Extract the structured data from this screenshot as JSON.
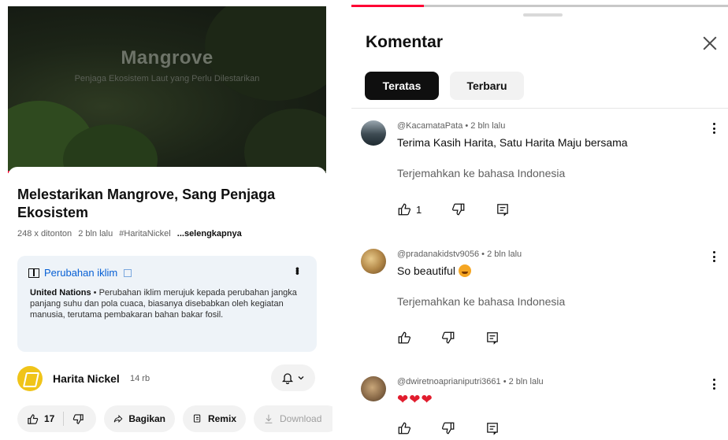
{
  "video": {
    "overlay_title": "Mangrove",
    "overlay_subtitle": "Penjaga Ekosistem Laut yang Perlu Dilestarikan",
    "progress": 0.05
  },
  "details": {
    "title": "Melestarikan Mangrove, Sang Penjaga Ekosistem",
    "views": "248 x ditonton",
    "age": "2 bln lalu",
    "hashtag": "#HaritaNickel",
    "more_label": "...selengkapnya"
  },
  "info_panel": {
    "topic": "Perubahan iklim",
    "source": "United Nations",
    "body": " • Perubahan iklim merujuk kepada perubahan jangka panjang suhu dan pola cuaca, biasanya disebabkan oleh kegiatan manusia, terutama pembakaran bahan bakar fosil."
  },
  "channel": {
    "name": "Harita Nickel",
    "subscribers": "14 rb"
  },
  "actions": {
    "likes": "17",
    "share_label": "Bagikan",
    "remix_label": "Remix",
    "download_label": "Download"
  },
  "comments_panel": {
    "title": "Komentar",
    "tabs": [
      {
        "label": "Teratas",
        "active": true
      },
      {
        "label": "Terbaru",
        "active": false
      }
    ],
    "translate_label": "Terjemahkan ke bahasa Indonesia",
    "items": [
      {
        "author": "@KacamataPata",
        "time": "2 bln lalu",
        "text": "Terima Kasih Harita, Satu Harita Maju bersama",
        "likes": "1"
      },
      {
        "author": "@pradanakidstv9056",
        "time": "2 bln lalu",
        "text": "So beautiful",
        "likes": ""
      },
      {
        "author": "@dwiretnoaprianiputri3661",
        "time": "2 bln lalu",
        "text": "❤❤❤",
        "likes": ""
      }
    ]
  },
  "colors": {
    "accent_red": "#ff0033",
    "link_blue": "#065fd4",
    "channel_yellow": "#f0c419"
  }
}
